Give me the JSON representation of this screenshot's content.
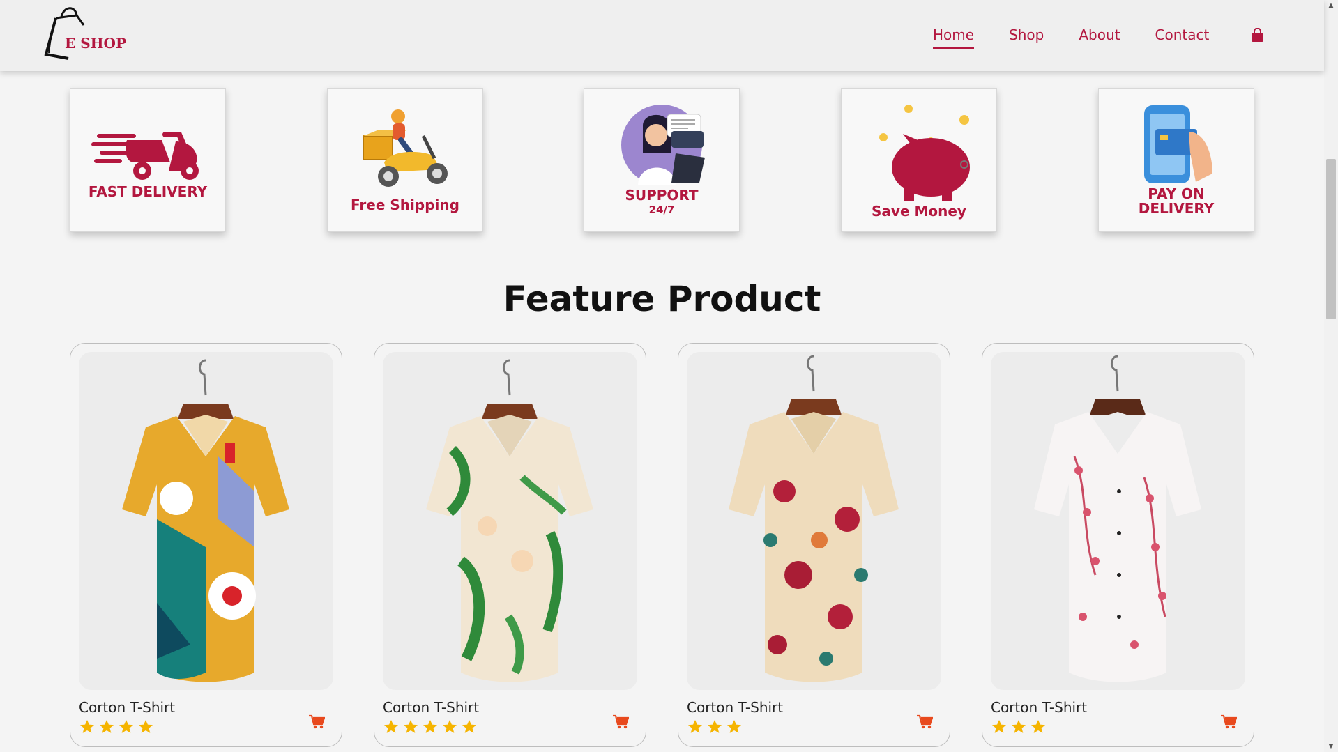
{
  "brand": {
    "logo_text": "E SHOP"
  },
  "nav": {
    "items": [
      {
        "label": "Home",
        "active": true
      },
      {
        "label": "Shop",
        "active": false
      },
      {
        "label": "About",
        "active": false
      },
      {
        "label": "Contact",
        "active": false
      }
    ],
    "cart_icon": "shopping-bag-icon"
  },
  "colors": {
    "accent": "#b3173f",
    "star": "#f5b400",
    "cart": "#e8491d",
    "header_bg": "#efefef",
    "page_bg": "#f4f4f4"
  },
  "services": [
    {
      "label": "FAST DELIVERY",
      "icon": "scooter-icon"
    },
    {
      "label": "Free Shipping",
      "icon": "delivery-rider-icon"
    },
    {
      "label": "SUPPORT",
      "sublabel": "24/7",
      "icon": "support-agent-icon"
    },
    {
      "label": "Save Money",
      "icon": "piggy-bank-icon"
    },
    {
      "label": "PAY ON\nDELIVERY",
      "icon": "phone-payment-icon"
    }
  ],
  "featured": {
    "title": "Feature Product",
    "products": [
      {
        "name": "Corton T-Shirt",
        "rating": 4,
        "image": "abstract-print-shirt"
      },
      {
        "name": "Corton T-Shirt",
        "rating": 5,
        "image": "leaf-print-shirt"
      },
      {
        "name": "Corton T-Shirt",
        "rating": 3,
        "image": "rose-print-shirt"
      },
      {
        "name": "Corton T-Shirt",
        "rating": 3,
        "image": "blossom-print-shirt"
      }
    ]
  }
}
